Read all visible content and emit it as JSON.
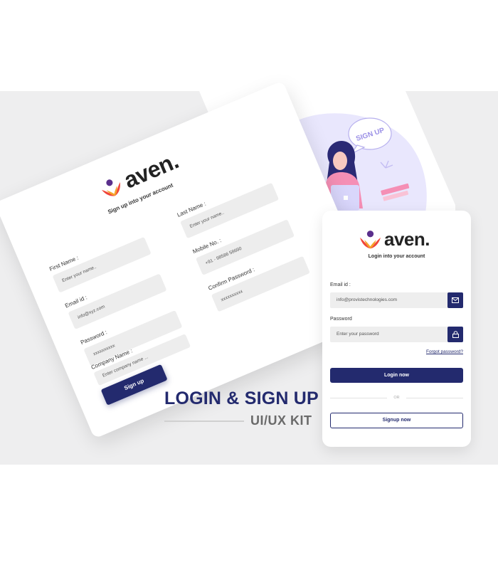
{
  "brand": {
    "name": "aven."
  },
  "colors": {
    "primary": "#232a6e",
    "field": "#eeeeee",
    "background": "#eeeeef",
    "blob": "#e9e7fd"
  },
  "signup_sheet": {
    "subtitle": "Sign up into your account",
    "fields": [
      {
        "label": "First Name :",
        "value": "Enter your name.."
      },
      {
        "label": "Last Name :",
        "value": "Enter your name.."
      },
      {
        "label": "Email id :",
        "value": "info@xyz.com"
      },
      {
        "label": "Mobile No. :",
        "value": "+91 - 98586 58690"
      },
      {
        "label": "Password :",
        "value": "xxxxxxxxxx"
      },
      {
        "label": "Confirm Password :",
        "value": "xxxxxxxxxx"
      },
      {
        "label": "Company Name :",
        "value": "Enter company name ..."
      }
    ],
    "button": "Sign up"
  },
  "illustration": {
    "bubble_text": "SIGN UP"
  },
  "headline": {
    "title": "LOGIN & SIGN UP",
    "subtitle": "UI/UX KIT"
  },
  "login_card": {
    "subtitle": "Login into your account",
    "email": {
      "label": "Email id :",
      "value": "info@provistechnologies.com",
      "icon": "mail-icon"
    },
    "password": {
      "label": "Password",
      "placeholder": "Enter your password",
      "icon": "lock-icon"
    },
    "forgot": "Forgot password?",
    "login_button": "Login now",
    "divider": "OR",
    "signup_button": "Signup now"
  }
}
